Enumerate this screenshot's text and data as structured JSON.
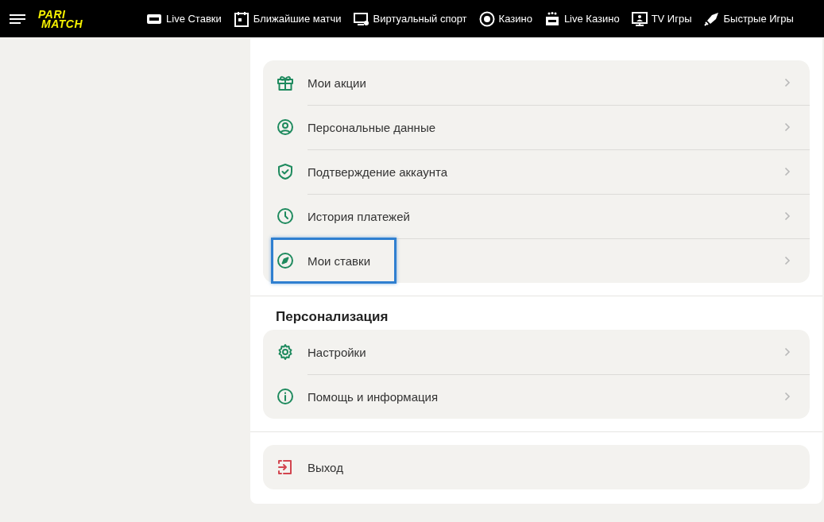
{
  "header": {
    "logo": [
      "PARI",
      "MATCH"
    ],
    "nav": [
      {
        "kind": "live",
        "label": "Live Ставки"
      },
      {
        "kind": "calendar",
        "label": "Ближайшие матчи"
      },
      {
        "kind": "monitor",
        "label": "Виртуальный спорт"
      },
      {
        "kind": "chip",
        "label": "Казино"
      },
      {
        "kind": "livecasino",
        "label": "Live Казино"
      },
      {
        "kind": "tv",
        "label": "TV Игры"
      },
      {
        "kind": "rocket",
        "label": "Быстрые Игры"
      }
    ]
  },
  "sections": [
    {
      "items": [
        {
          "kind": "gift",
          "label": "Мои акции",
          "highlighted": false
        },
        {
          "kind": "user",
          "label": "Персональные данные",
          "highlighted": false
        },
        {
          "kind": "shield",
          "label": "Подтверждение аккаунта",
          "highlighted": false
        },
        {
          "kind": "clock",
          "label": "История платежей",
          "highlighted": false
        },
        {
          "kind": "compass",
          "label": "Мои ставки",
          "highlighted": true
        }
      ]
    },
    {
      "title": "Персонализация",
      "items": [
        {
          "kind": "gear",
          "label": "Настройки",
          "highlighted": false
        },
        {
          "kind": "info",
          "label": "Помощь и информация",
          "highlighted": false
        }
      ]
    },
    {
      "items": [
        {
          "kind": "exit",
          "label": "Выход",
          "highlighted": false
        }
      ]
    }
  ]
}
